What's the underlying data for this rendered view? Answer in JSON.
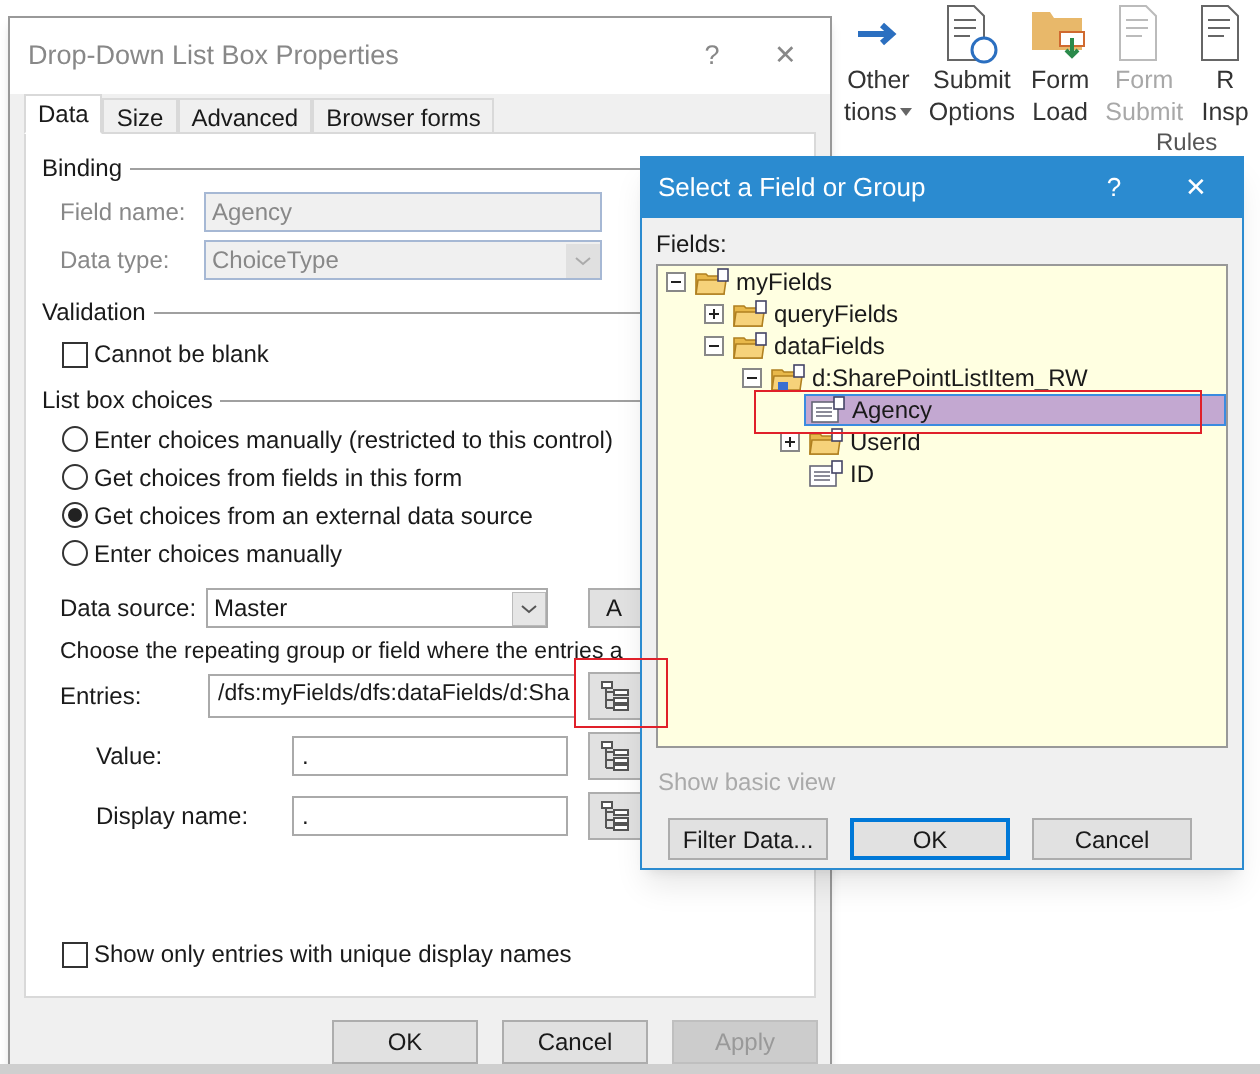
{
  "ribbon": {
    "items": [
      {
        "lines": [
          "Other",
          "tions"
        ],
        "dropdown": true,
        "disabled": false
      },
      {
        "lines": [
          "Submit",
          "Options"
        ],
        "dropdown": false,
        "disabled": false
      },
      {
        "lines": [
          "Form",
          "Load"
        ],
        "dropdown": false,
        "disabled": false
      },
      {
        "lines": [
          "Form",
          "Submit"
        ],
        "dropdown": false,
        "disabled": true
      },
      {
        "lines": [
          "R",
          "Insp"
        ],
        "dropdown": false,
        "disabled": false
      }
    ],
    "group_label": "Rules"
  },
  "properties_dialog": {
    "title": "Drop-Down List Box Properties",
    "help": "?",
    "close": "✕",
    "tabs": [
      {
        "label": "Data",
        "selected": true
      },
      {
        "label": "Size",
        "selected": false
      },
      {
        "label": "Advanced",
        "selected": false
      },
      {
        "label": "Browser forms",
        "selected": false
      }
    ],
    "binding": {
      "heading": "Binding",
      "field_name_label": "Field name:",
      "field_name": "Agency",
      "data_type_label": "Data type:",
      "data_type": "ChoiceType"
    },
    "validation": {
      "heading": "Validation",
      "cannot_be_blank": {
        "label": "Cannot be blank",
        "checked": false
      }
    },
    "list_box_choices": {
      "heading": "List box choices",
      "options": [
        {
          "label": "Enter choices manually (restricted to this control)",
          "selected": false
        },
        {
          "label": "Get choices from fields in this form",
          "selected": false
        },
        {
          "label": "Get choices from an external data source",
          "selected": true
        },
        {
          "label": "Enter choices manually",
          "selected": false
        }
      ]
    },
    "data_source_label": "Data source:",
    "data_source": "Master",
    "add_button": "A",
    "hint": "Choose the repeating group or field where the entries a",
    "entries_label": "Entries:",
    "entries": "/dfs:myFields/dfs:dataFields/d:Sha",
    "value_label": "Value:",
    "value": ".",
    "display_name_label": "Display name:",
    "display_name": ".",
    "unique_names": {
      "label": "Show only entries with unique display names",
      "checked": false
    },
    "buttons": [
      {
        "label": "OK",
        "disabled": false
      },
      {
        "label": "Cancel",
        "disabled": false
      },
      {
        "label": "Apply",
        "disabled": true
      }
    ]
  },
  "select_dialog": {
    "title": "Select a Field or Group",
    "help": "?",
    "close": "✕",
    "fields_label": "Fields:",
    "tree": [
      {
        "label": "myFields",
        "kind": "group",
        "expanded": true,
        "selected": false,
        "children": [
          {
            "label": "queryFields",
            "kind": "group",
            "expanded": false,
            "selected": false
          },
          {
            "label": "dataFields",
            "kind": "group",
            "expanded": true,
            "selected": false,
            "children": [
              {
                "label": "d:SharePointListItem_RW",
                "kind": "repeating",
                "expanded": true,
                "selected": false,
                "children": [
                  {
                    "label": "Agency",
                    "kind": "field",
                    "selected": true
                  },
                  {
                    "label": "UserId",
                    "kind": "group",
                    "expanded": false,
                    "selected": false
                  },
                  {
                    "label": "ID",
                    "kind": "field",
                    "selected": false
                  }
                ]
              }
            ]
          }
        ]
      }
    ],
    "show_basic_view": "Show basic view",
    "buttons": [
      {
        "label": "Filter Data...",
        "default": false
      },
      {
        "label": "OK",
        "default": true
      },
      {
        "label": "Cancel",
        "default": false
      }
    ]
  }
}
